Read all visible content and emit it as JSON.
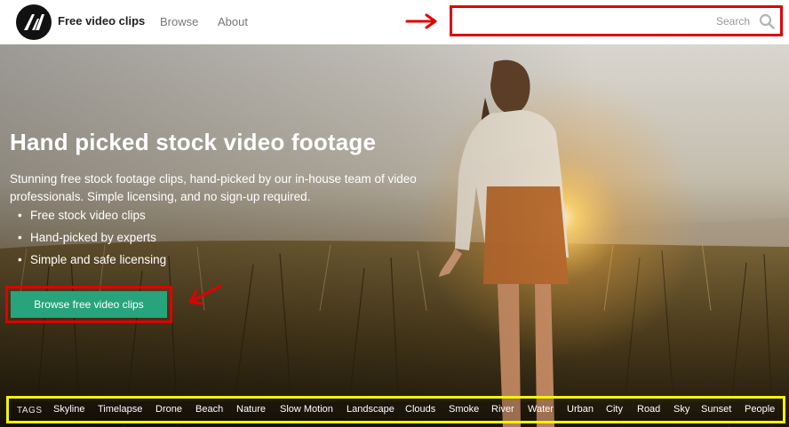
{
  "header": {
    "brand": "Free video clips",
    "nav": {
      "browse": "Browse",
      "about": "About"
    },
    "search": {
      "placeholder": "Search",
      "value": ""
    }
  },
  "hero": {
    "title": "Hand picked stock video footage",
    "description": "Stunning free stock footage clips, hand-picked by our in-house team of video professionals. Simple licensing, and no sign-up required.",
    "features": [
      "Free stock video clips",
      "Hand-picked by experts",
      "Simple and safe licensing"
    ],
    "cta_label": "Browse free video clips"
  },
  "tags": {
    "label": "TAGS",
    "items": [
      "Skyline",
      "Timelapse",
      "Drone",
      "Beach",
      "Nature",
      "Slow Motion",
      "Landscape",
      "Clouds",
      "Smoke",
      "River",
      "Water",
      "Urban",
      "City",
      "Road",
      "Sky",
      "Sunset",
      "People"
    ]
  },
  "colors": {
    "cta_green": "#27a47b",
    "annotation_red": "#e00000",
    "annotation_yellow": "#f4f400",
    "brand_dark": "#111111"
  },
  "icons": {
    "logo": "stylized-M-logo",
    "search": "search-icon",
    "annotation_arrows": "red-arrow"
  }
}
